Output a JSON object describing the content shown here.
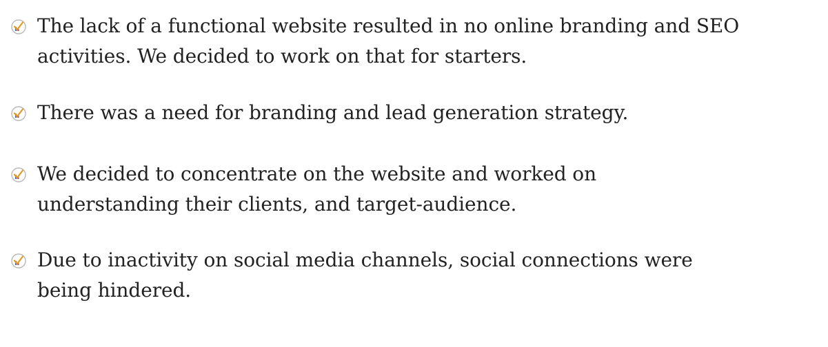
{
  "bullets": [
    {
      "icon": "chart-check-icon",
      "text": "The lack of a functional website resulted in no online branding and SEO\nactivities. We decided to work on that for starters."
    },
    {
      "icon": "chart-check-icon",
      "text": "There was a need for branding and lead generation strategy."
    },
    {
      "icon": "chart-check-icon",
      "text": "We decided to concentrate on the website and worked on\nunderstanding their clients, and target-audience."
    },
    {
      "icon": "chart-check-icon",
      "text": "Due to inactivity on social media channels, social connections were\nbeing hindered."
    }
  ],
  "colors": {
    "text": "#222222",
    "icon_ring": "#b9b9b9",
    "icon_check": "#e79a1b",
    "icon_bar_blue": "#2f6fd6",
    "icon_bar_red": "#d9342b"
  }
}
